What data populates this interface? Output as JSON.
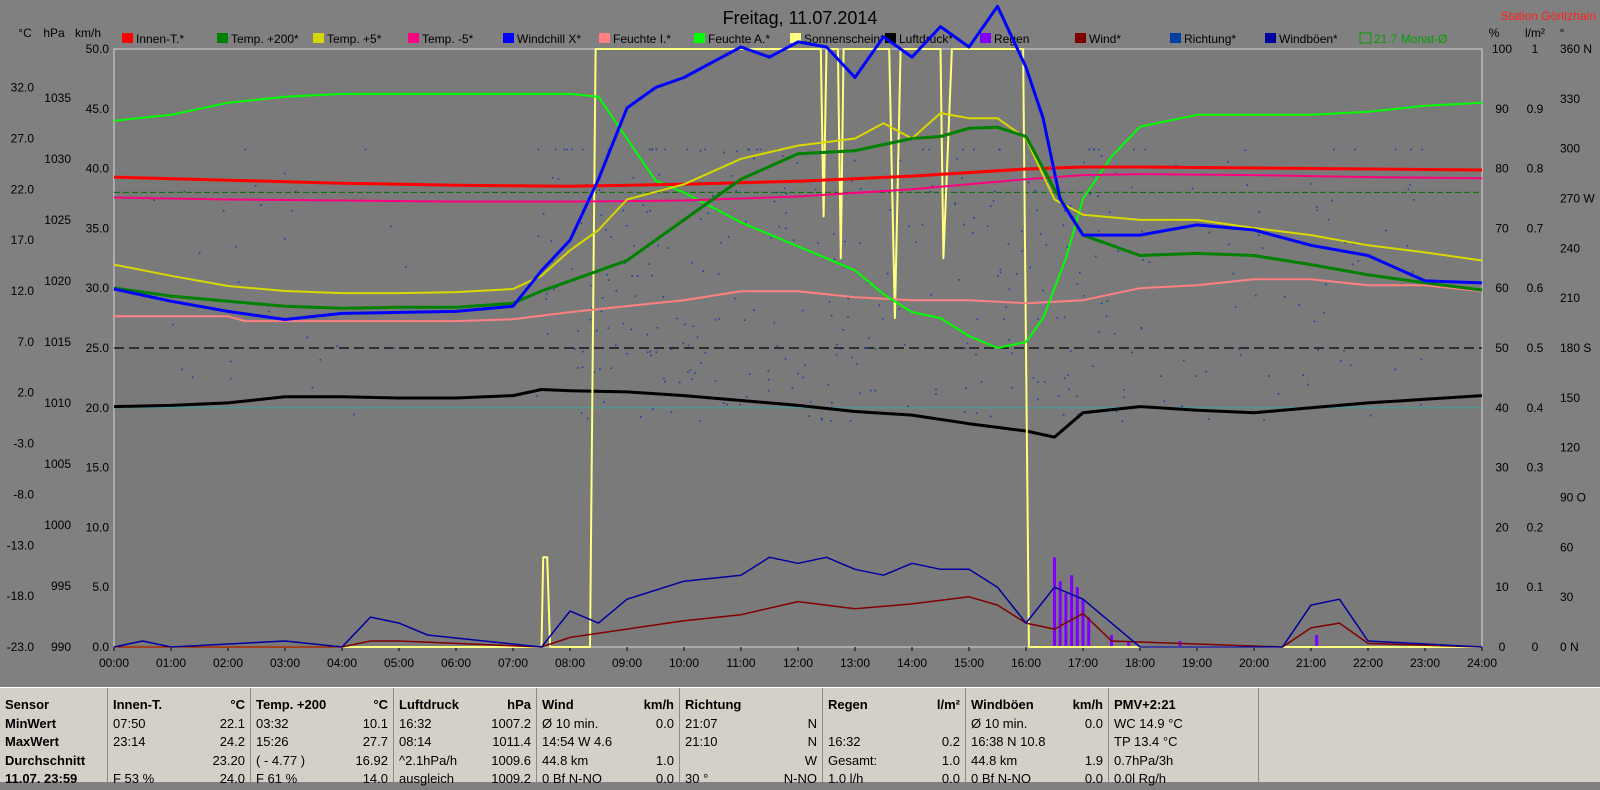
{
  "chart_data": {
    "type": "line",
    "title": "Freitag, 11.07.2014",
    "station": "Station Göritzhain",
    "x_ticks": [
      "00:00",
      "01:00",
      "02:00",
      "03:00",
      "04:00",
      "05:00",
      "06:00",
      "07:00",
      "08:00",
      "09:00",
      "10:00",
      "11:00",
      "12:00",
      "13:00",
      "14:00",
      "15:00",
      "16:00",
      "17:00",
      "18:00",
      "19:00",
      "20:00",
      "21:00",
      "22:00",
      "23:00",
      "24:00"
    ],
    "x_range_hours": [
      0,
      24
    ],
    "axes": {
      "temp_c": {
        "unit": "°C",
        "ticks": [
          "32.0",
          "27.0",
          "22.0",
          "17.0",
          "12.0",
          "7.0",
          "2.0",
          "-3.0",
          "-8.0",
          "-13.0",
          "-18.0",
          "-23.0"
        ],
        "range": [
          -23,
          35.8
        ]
      },
      "pressure_hpa": {
        "unit": "hPa",
        "ticks": [
          "1035",
          "1030",
          "1025",
          "1020",
          "1015",
          "1010",
          "1005",
          "1000",
          "995",
          "990"
        ],
        "range": [
          990,
          1039
        ]
      },
      "speed_kmh": {
        "unit": "km/h",
        "ticks": [
          "50.0",
          "45.0",
          "40.0",
          "35.0",
          "30.0",
          "25.0",
          "20.0",
          "15.0",
          "10.0",
          "5.0",
          "0.0"
        ],
        "range": [
          0,
          50
        ]
      },
      "percent": {
        "unit": "%",
        "ticks": [
          "100",
          "90",
          "80",
          "70",
          "60",
          "50",
          "40",
          "30",
          "20",
          "10",
          "0"
        ],
        "range": [
          0,
          100
        ]
      },
      "rain_lm2": {
        "unit": "l/m²",
        "ticks": [
          "1",
          "0.9",
          "0.8",
          "0.7",
          "0.6",
          "0.5",
          "0.4",
          "0.3",
          "0.2",
          "0.1",
          "0"
        ],
        "range": [
          0,
          1
        ]
      },
      "direction_deg": {
        "unit": "°",
        "ticks": [
          "360 N",
          "330",
          "300",
          "270 W",
          "240",
          "210",
          "180 S",
          "150",
          "120",
          "90 O",
          "60",
          "30",
          "0 N"
        ],
        "range": [
          0,
          360
        ]
      }
    },
    "legend": [
      {
        "label": "Innen-T.*",
        "color": "#ff0000"
      },
      {
        "label": "Temp. +200*",
        "color": "#008000"
      },
      {
        "label": "Temp. +5*",
        "color": "#d8d800"
      },
      {
        "label": "Temp. -5*",
        "color": "#ff0080"
      },
      {
        "label": "Windchill X*",
        "color": "#0000ff"
      },
      {
        "label": "Feuchte I.*",
        "color": "#ff8080"
      },
      {
        "label": "Feuchte A.*",
        "color": "#00ff00"
      },
      {
        "label": "Sonnenschein*",
        "color": "#ffff80"
      },
      {
        "label": "Luftdruck*",
        "color": "#000000"
      },
      {
        "label": "Regen",
        "color": "#8000ff"
      },
      {
        "label": "Wind*",
        "color": "#800000"
      },
      {
        "label": "Richtung*",
        "color": "#0040a0"
      },
      {
        "label": "Windböen*",
        "color": "#0000a0"
      },
      {
        "label": "21.7 Monat-Ø",
        "color": "#00a000"
      }
    ],
    "month_avg_temp": 21.7,
    "series": [
      {
        "name": "Innen-T.*",
        "axis": "temp_c",
        "color": "#ff0000",
        "x": [
          0,
          2,
          4,
          6,
          8,
          10,
          12,
          14,
          16,
          17,
          18,
          20,
          22,
          24
        ],
        "y": [
          23.2,
          22.9,
          22.6,
          22.4,
          22.3,
          22.5,
          22.8,
          23.3,
          24.0,
          24.2,
          24.2,
          24.1,
          24.0,
          23.9
        ]
      },
      {
        "name": "Temp. +200*",
        "axis": "temp_c",
        "color": "#008000",
        "x": [
          0,
          1,
          2,
          3,
          4,
          5,
          6,
          7,
          7.5,
          8,
          9,
          10,
          11,
          12,
          13,
          14,
          14.5,
          15,
          15.5,
          16,
          16.5,
          17,
          18,
          19,
          20,
          21,
          22,
          23,
          24
        ],
        "y": [
          12.3,
          11.5,
          11,
          10.5,
          10.3,
          10.4,
          10.4,
          10.8,
          12,
          13,
          15,
          19,
          23,
          25.5,
          25.8,
          27,
          27.2,
          28,
          28.1,
          27.2,
          22,
          17.5,
          15.5,
          15.7,
          15.5,
          14.6,
          13.6,
          12.8,
          12.1
        ]
      },
      {
        "name": "Temp. +5*",
        "axis": "temp_c",
        "color": "#d8d800",
        "x": [
          0,
          1,
          2,
          3,
          4,
          5,
          6,
          7,
          7.5,
          8,
          8.5,
          9,
          10,
          11,
          12,
          13,
          13.5,
          14,
          14.5,
          15,
          15.5,
          16,
          16.5,
          17,
          18,
          19,
          20,
          21,
          22,
          23,
          24
        ],
        "y": [
          14.6,
          13.5,
          12.5,
          12,
          11.8,
          11.8,
          11.9,
          12.2,
          13.5,
          16,
          18,
          21,
          22.5,
          25,
          26.3,
          27,
          28.5,
          27,
          29.5,
          29,
          29,
          27,
          21,
          19.5,
          19,
          19,
          18.2,
          17.5,
          16.5,
          15.8,
          15
        ]
      },
      {
        "name": "Temp. -5*",
        "axis": "temp_c",
        "color": "#ff0080",
        "x": [
          0,
          2,
          4,
          6,
          8,
          10,
          12,
          14,
          16,
          17,
          18,
          20,
          22,
          24
        ],
        "y": [
          21.2,
          21.0,
          20.9,
          20.8,
          20.8,
          20.9,
          21.3,
          22.0,
          23.0,
          23.4,
          23.5,
          23.4,
          23.2,
          23.1
        ]
      },
      {
        "name": "Windchill X*",
        "axis": "temp_c",
        "color": "#0000ff",
        "x": [
          0,
          1,
          2,
          3,
          4,
          5,
          6,
          7,
          7.5,
          8,
          8.5,
          9,
          9.5,
          10,
          10.5,
          11,
          11.5,
          12,
          12.5,
          13,
          13.5,
          14,
          14.5,
          15,
          15.5,
          16,
          16.3,
          16.6,
          17,
          18,
          19,
          20,
          21,
          22,
          23,
          24
        ],
        "y": [
          12.2,
          11,
          10,
          9.2,
          9.8,
          9.9,
          10,
          10.5,
          14,
          17,
          23,
          30,
          32,
          33,
          34.5,
          36,
          35,
          36.5,
          36,
          33,
          37,
          35,
          38,
          36,
          40,
          34,
          29,
          21,
          17.5,
          17.5,
          18.5,
          18,
          16.5,
          15.5,
          13,
          12.8
        ]
      },
      {
        "name": "Feuchte I.*",
        "axis": "percent",
        "color": "#ff8080",
        "x": [
          0,
          2,
          2.3,
          4,
          6,
          7,
          8,
          9,
          10,
          11,
          12,
          13,
          14,
          15,
          16,
          17,
          18,
          19,
          20,
          21,
          22,
          23,
          24
        ],
        "y": [
          55.3,
          55.3,
          54.5,
          54.5,
          54.5,
          54.8,
          56,
          57,
          58,
          59.5,
          59.5,
          58.5,
          58,
          58,
          57.5,
          58,
          60,
          60.5,
          61.5,
          61.5,
          60.5,
          60.5,
          59.5
        ]
      },
      {
        "name": "Feuchte A.*",
        "axis": "percent",
        "color": "#00ff00",
        "x": [
          0,
          1,
          2,
          3,
          4,
          5,
          6,
          7,
          8,
          8.5,
          9,
          9.5,
          10,
          11,
          12,
          13,
          13.5,
          14,
          14.5,
          15,
          15.5,
          16,
          16.3,
          16.7,
          17,
          17.5,
          18,
          19,
          20,
          21,
          22,
          23,
          24
        ],
        "y": [
          88,
          89,
          91,
          92,
          92.5,
          92.5,
          92.5,
          92.5,
          92.5,
          92,
          85,
          78,
          76,
          71,
          67,
          63,
          59,
          56,
          55,
          52,
          50,
          51,
          55,
          65,
          75,
          82,
          87,
          89,
          89,
          89,
          89.5,
          90.5,
          91
        ]
      },
      {
        "name": "Luftdruck*",
        "axis": "pressure_hpa",
        "color": "#000000",
        "x": [
          0,
          1,
          2,
          3,
          4,
          5,
          6,
          7,
          7.5,
          8,
          9,
          10,
          11,
          12,
          13,
          14,
          15,
          16,
          16.5,
          17,
          18,
          19,
          20,
          21,
          22,
          23,
          24
        ],
        "y": [
          1009.7,
          1009.8,
          1010,
          1010.5,
          1010.5,
          1010.4,
          1010.4,
          1010.6,
          1011.1,
          1011,
          1010.9,
          1010.6,
          1010.2,
          1009.8,
          1009.3,
          1009,
          1008.3,
          1007.7,
          1007.2,
          1009.2,
          1009.7,
          1009.4,
          1009.2,
          1009.6,
          1010,
          1010.3,
          1010.6
        ]
      },
      {
        "name": "Sonnenschein*",
        "axis": "percent",
        "color": "#ffff80",
        "x": [
          0,
          7.5,
          7.53,
          7.6,
          7.65,
          8.35,
          8.45,
          12.4,
          12.45,
          12.5,
          12.7,
          12.75,
          12.8,
          13.6,
          13.7,
          13.8,
          13.9,
          14.5,
          14.55,
          14.7,
          14.75,
          15.95,
          16.05,
          24
        ],
        "y": [
          0,
          0,
          15,
          15,
          0,
          0,
          100,
          100,
          72,
          100,
          100,
          65,
          100,
          100,
          55,
          100,
          100,
          100,
          65,
          100,
          100,
          100,
          0,
          0
        ]
      },
      {
        "name": "Wind*",
        "axis": "speed_kmh",
        "color": "#800000",
        "x": [
          0,
          4,
          4.5,
          5,
          7.5,
          8,
          9,
          10,
          11,
          12,
          13,
          14,
          15,
          15.5,
          16,
          16.5,
          17,
          17.5,
          20.5,
          21,
          21.5,
          22,
          24
        ],
        "y": [
          0,
          0,
          0.5,
          0.5,
          0,
          0.8,
          1.5,
          2.2,
          2.7,
          3.8,
          3.2,
          3.6,
          4.2,
          3.5,
          2,
          1.5,
          2.8,
          0.5,
          0,
          1.6,
          2,
          0.3,
          0
        ]
      },
      {
        "name": "Windböen*",
        "axis": "speed_kmh",
        "color": "#0000a0",
        "x": [
          0,
          0.5,
          1,
          3,
          4,
          4.5,
          5,
          5.5,
          7.5,
          8,
          8.5,
          9,
          10,
          11,
          11.5,
          12,
          12.5,
          13,
          13.5,
          14,
          14.5,
          15,
          15.5,
          16,
          16.5,
          17,
          17.5,
          18,
          20.5,
          21,
          21.5,
          22,
          24
        ],
        "y": [
          0,
          0.5,
          0,
          0.5,
          0,
          2.5,
          2,
          1,
          0,
          3,
          2,
          4,
          5.5,
          6,
          7.5,
          7,
          7.5,
          6.5,
          6,
          7,
          6.5,
          6.5,
          5,
          2,
          5,
          4,
          2,
          0,
          0,
          3.5,
          4,
          0.5,
          0
        ]
      },
      {
        "name": "Regen",
        "axis": "rain_lm2",
        "color": "#8000ff",
        "bars_x": [
          16.5,
          16.6,
          16.7,
          16.8,
          16.9,
          17.0,
          17.1,
          17.5,
          17.8,
          18.7,
          21.1
        ],
        "bars_y": [
          0.15,
          0.11,
          0.09,
          0.12,
          0.1,
          0.08,
          0.05,
          0.02,
          0.01,
          0.01,
          0.02
        ]
      }
    ]
  },
  "panel": {
    "columns": [
      {
        "head": [
          "Sensor",
          ""
        ],
        "rows": [
          [
            "MinWert",
            ""
          ],
          [
            "MaxWert",
            ""
          ],
          [
            "Durchschnitt",
            ""
          ],
          [
            "11.07. 23:59",
            ""
          ]
        ]
      },
      {
        "head": [
          "Innen-T.",
          "°C"
        ],
        "rows": [
          [
            "07:50",
            "22.1"
          ],
          [
            "23:14",
            "24.2"
          ],
          [
            "",
            "23.20"
          ],
          [
            "F 53 %",
            "24.0"
          ]
        ]
      },
      {
        "head": [
          "Temp. +200",
          "°C"
        ],
        "rows": [
          [
            "03:32",
            "10.1"
          ],
          [
            "15:26",
            "27.7"
          ],
          [
            "( - 4.77 )",
            "16.92"
          ],
          [
            "F 61 %",
            "14.0"
          ]
        ]
      },
      {
        "head": [
          "Luftdruck",
          "hPa"
        ],
        "rows": [
          [
            "16:32",
            "1007.2"
          ],
          [
            "08:14",
            "1011.4"
          ],
          [
            "^2.1hPa/h",
            "1009.6"
          ],
          [
            "ausgleich",
            "1009.2"
          ]
        ]
      },
      {
        "head": [
          "Wind",
          "km/h"
        ],
        "rows": [
          [
            "Ø 10 min.",
            "0.0"
          ],
          [
            "14:54   W 4.6",
            ""
          ],
          [
            "44.8 km",
            "1.0"
          ],
          [
            "0 Bf N-NO",
            "0.0"
          ]
        ]
      },
      {
        "head": [
          "Richtung",
          ""
        ],
        "rows": [
          [
            "21:07",
            "N"
          ],
          [
            "21:10",
            "N"
          ],
          [
            "",
            "W"
          ],
          [
            "30 °",
            "N-NO"
          ]
        ]
      },
      {
        "head": [
          "Regen",
          "l/m²"
        ],
        "rows": [
          [
            "",
            ""
          ],
          [
            "16:32",
            "0.2"
          ],
          [
            "Gesamt:",
            "1.0"
          ],
          [
            "1.0 l/h",
            "0.0"
          ]
        ]
      },
      {
        "head": [
          "Windböen",
          "km/h"
        ],
        "rows": [
          [
            "Ø 10 min.",
            "0.0"
          ],
          [
            "16:38   N 10.8",
            ""
          ],
          [
            "44.8 km",
            "1.9"
          ],
          [
            "0 Bf N-NO",
            "0.0"
          ]
        ]
      },
      {
        "head": [
          "PMV+2:21",
          ""
        ],
        "rows": [
          [
            "WC 14.9 °C",
            ""
          ],
          [
            "TP 13.4 °C",
            ""
          ],
          [
            "0.7hPa/3h",
            ""
          ],
          [
            "0.0l Rg/h",
            ""
          ]
        ]
      }
    ]
  }
}
